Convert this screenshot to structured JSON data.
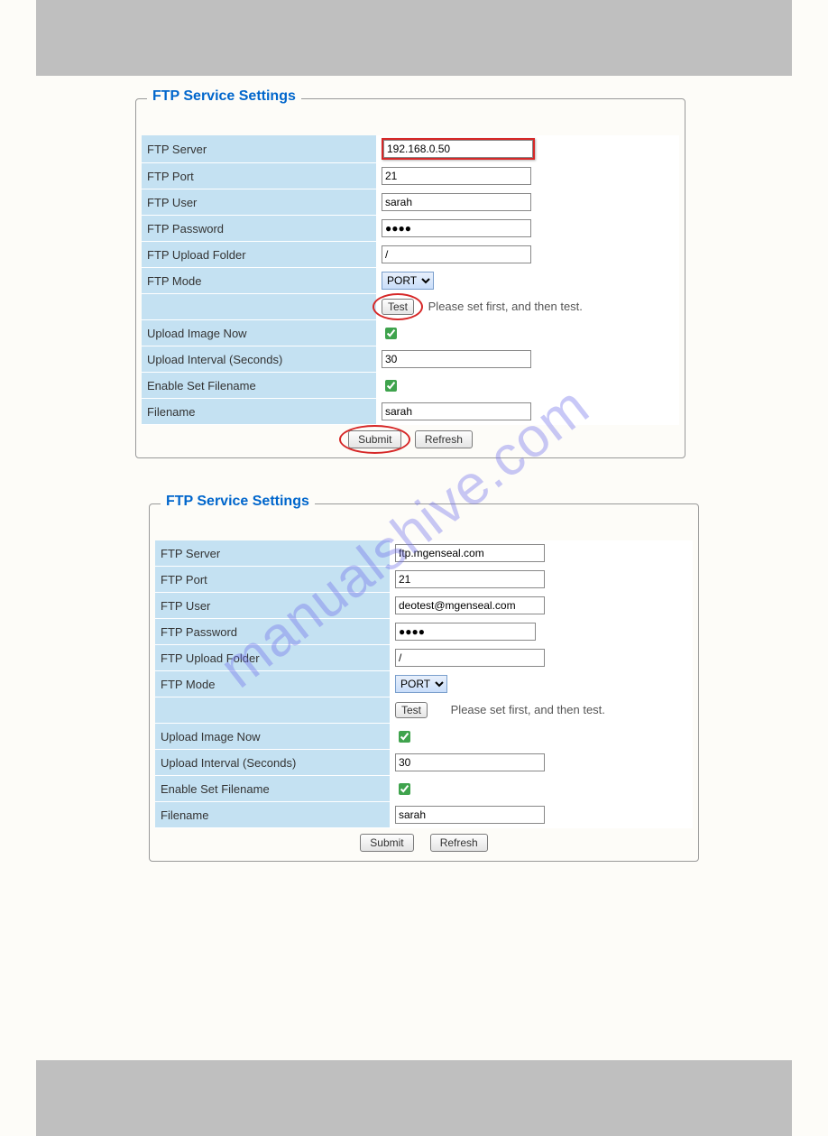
{
  "watermark": "manualshive.com",
  "panel1": {
    "legend": "FTP Service Settings",
    "rows": {
      "ftp_server_label": "FTP Server",
      "ftp_server_value": "192.168.0.50",
      "ftp_port_label": "FTP Port",
      "ftp_port_value": "21",
      "ftp_user_label": "FTP User",
      "ftp_user_value": "sarah",
      "ftp_password_label": "FTP Password",
      "ftp_password_value": "●●●●",
      "ftp_upload_folder_label": "FTP Upload Folder",
      "ftp_upload_folder_value": "/",
      "ftp_mode_label": "FTP Mode",
      "ftp_mode_value": "PORT",
      "test_button": "Test",
      "test_hint": "Please set first, and then test.",
      "upload_image_now_label": "Upload Image Now",
      "upload_interval_label": "Upload Interval (Seconds)",
      "upload_interval_value": "30",
      "enable_set_filename_label": "Enable Set Filename",
      "filename_label": "Filename",
      "filename_value": "sarah"
    },
    "buttons": {
      "submit": "Submit",
      "refresh": "Refresh"
    }
  },
  "panel2": {
    "legend": "FTP Service Settings",
    "rows": {
      "ftp_server_label": "FTP Server",
      "ftp_server_value": "ftp.mgenseal.com",
      "ftp_port_label": "FTP Port",
      "ftp_port_value": "21",
      "ftp_user_label": "FTP User",
      "ftp_user_value": "deotest@mgenseal.com",
      "ftp_password_label": "FTP Password",
      "ftp_password_value": "●●●●",
      "ftp_upload_folder_label": "FTP Upload Folder",
      "ftp_upload_folder_value": "/",
      "ftp_mode_label": "FTP Mode",
      "ftp_mode_value": "PORT",
      "test_button": "Test",
      "test_hint": "Please set first, and then test.",
      "upload_image_now_label": "Upload Image Now",
      "upload_interval_label": "Upload Interval (Seconds)",
      "upload_interval_value": "30",
      "enable_set_filename_label": "Enable Set Filename",
      "filename_label": "Filename",
      "filename_value": "sarah"
    },
    "buttons": {
      "submit": "Submit",
      "refresh": "Refresh"
    }
  }
}
